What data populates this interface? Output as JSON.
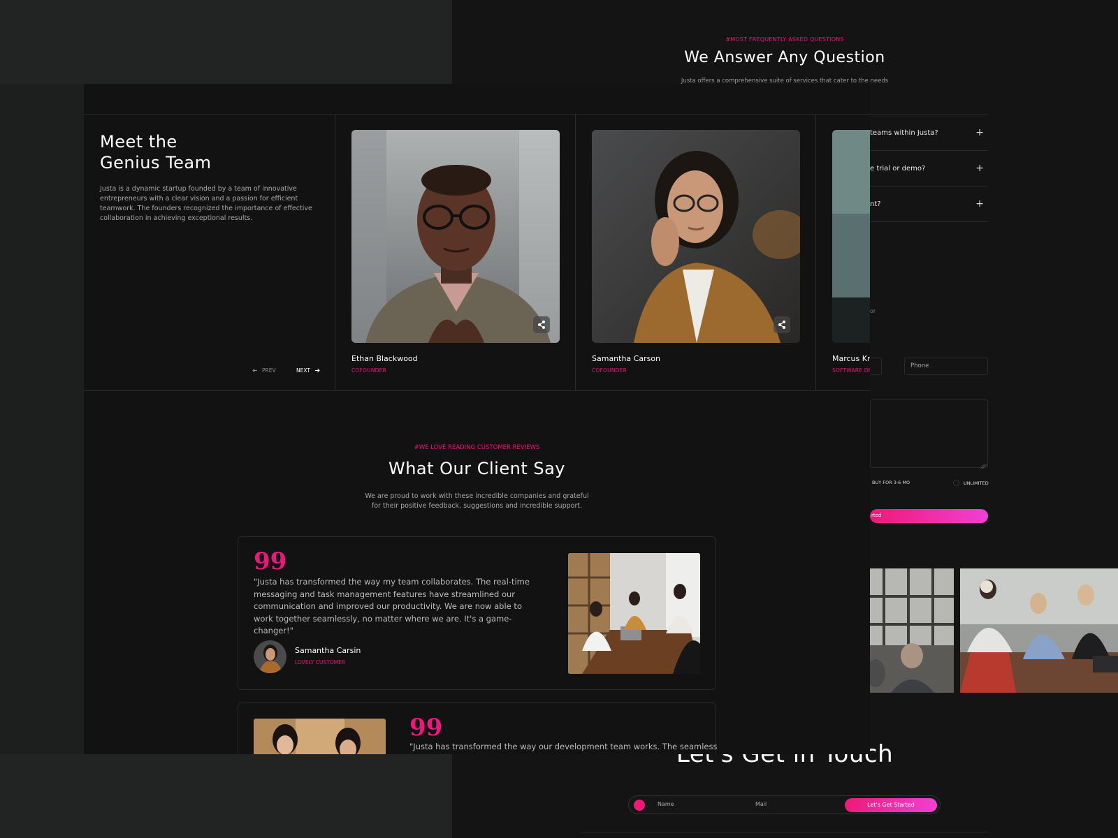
{
  "faq": {
    "kicker": "#MOST FREQUENTLY ASKED QUESTIONS",
    "title": "We Answer Any Question",
    "description": "Justa offers a comprehensive suite of services that cater to the needs of efficient ls.",
    "items": [
      {
        "question": "teams within Justa?"
      },
      {
        "question": "e trial or demo?"
      },
      {
        "question": "nt?"
      }
    ],
    "plus_icon": "+"
  },
  "contact_form": {
    "or_fragment": "or",
    "phone_placeholder": "Phone",
    "radio_options": [
      "BUY FOR 3-6 MO",
      "UNLIMITED"
    ],
    "submit_fragment": "rted"
  },
  "touch": {
    "title": "Let's Get in Touch",
    "name_placeholder": "Name",
    "mail_placeholder": "Mail",
    "button": "Let's Get Started"
  },
  "team": {
    "title_line1": "Meet the",
    "title_line2": "Genius Team",
    "description": "Justa is a dynamic startup founded by a team of innovative entrepreneurs with a clear vision and a passion for efficient teamwork. The founders recognized the importance of effective collaboration in achieving exceptional results.",
    "prev_label": "PREV",
    "next_label": "NEXT",
    "members": [
      {
        "name": "Ethan Blackwood",
        "role": "COFOUNDER"
      },
      {
        "name": "Samantha Carson",
        "role": "COFOUNDER"
      },
      {
        "name": "Marcus Kn",
        "role": "SOFTWARE DEV"
      }
    ]
  },
  "reviews": {
    "kicker": "#WE LOVE READING CUSTOMER REVIEWS",
    "title": "What Our Client Say",
    "description": "We are proud to work with these incredible companies and grateful for their positive feedback, suggestions and incredible support.",
    "quote_glyph": "99",
    "items": [
      {
        "quote": "\"Justa has transformed the way my team collaborates. The real-time messaging and task management features have streamlined our communication and improved our productivity. We are now able to work together seamlessly, no matter where we are. It's a game-changer!\"",
        "author": "Samantha Carsin",
        "role": "LOVELY CUSTOMER"
      },
      {
        "quote": "\"Justa has transformed the way our development team works. The seamless"
      }
    ]
  },
  "colors": {
    "accent": "#e8187d",
    "accent_gradient_end": "#f040d4",
    "page_bg": "#121212",
    "outer_bg": "#1d1f1f"
  }
}
